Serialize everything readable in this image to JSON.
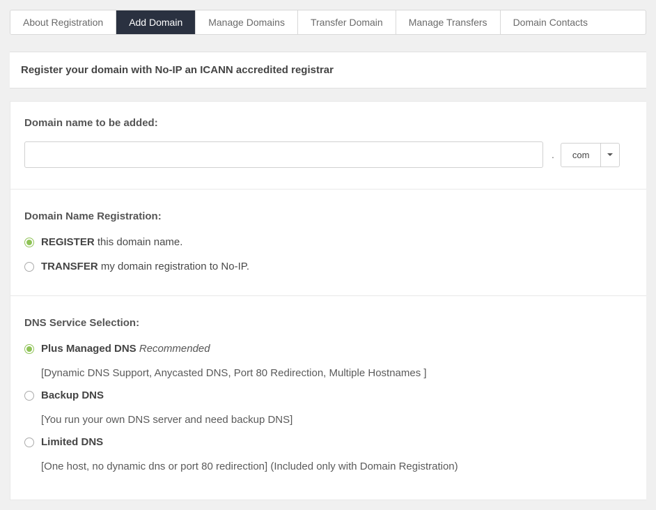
{
  "tabs": [
    {
      "label": "About Registration"
    },
    {
      "label": "Add Domain",
      "active": true
    },
    {
      "label": "Manage Domains"
    },
    {
      "label": "Transfer Domain"
    },
    {
      "label": "Manage Transfers"
    },
    {
      "label": "Domain Contacts"
    }
  ],
  "header": {
    "title": "Register your domain with No-IP an ICANN accredited registrar"
  },
  "domain": {
    "label": "Domain name to be added:",
    "input_value": "",
    "tld_selected": "com"
  },
  "registration": {
    "heading": "Domain Name Registration:",
    "options": {
      "register": {
        "bold": "REGISTER",
        "rest": " this domain name."
      },
      "transfer": {
        "bold": "TRANSFER",
        "rest": " my domain registration to No-IP."
      }
    }
  },
  "dns": {
    "heading": "DNS Service Selection:",
    "options": {
      "plus": {
        "title": "Plus Managed DNS",
        "tag": "Recommended",
        "desc": "[Dynamic DNS Support, Anycasted DNS, Port 80 Redirection, Multiple Hostnames ]"
      },
      "backup": {
        "title": "Backup DNS",
        "desc": "[You run your own DNS server and need backup DNS]"
      },
      "limited": {
        "title": "Limited DNS",
        "desc": "[One host, no dynamic dns or port 80 redirection] (Included only with Domain Registration)"
      }
    }
  }
}
